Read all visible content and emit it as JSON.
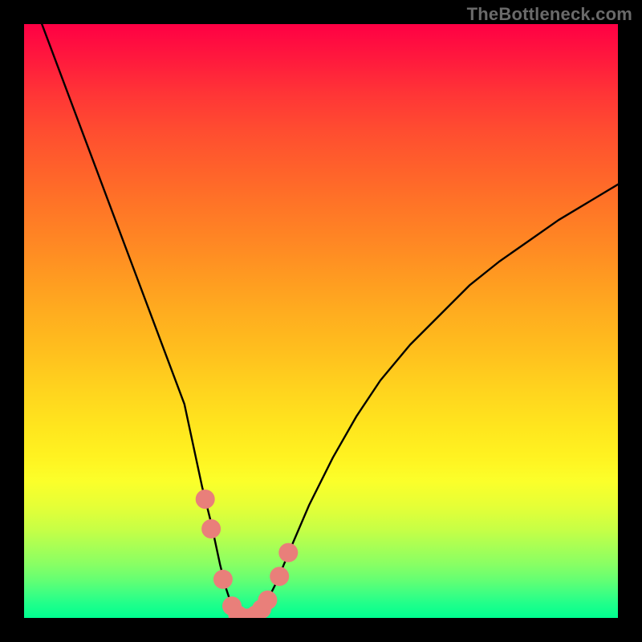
{
  "watermark": {
    "text": "TheBottleneck.com"
  },
  "chart_data": {
    "type": "line",
    "title": "",
    "xlabel": "",
    "ylabel": "",
    "xlim": [
      0,
      100
    ],
    "ylim": [
      0,
      100
    ],
    "grid": false,
    "series": [
      {
        "name": "bottleneck-curve",
        "color": "#000000",
        "x": [
          3,
          6,
          9,
          12,
          15,
          18,
          21,
          24,
          27,
          30,
          31.5,
          33,
          34,
          35,
          36,
          37,
          38,
          39,
          40,
          41,
          42.5,
          45,
          48,
          52,
          56,
          60,
          65,
          70,
          75,
          80,
          85,
          90,
          95,
          100
        ],
        "y": [
          100,
          92,
          84,
          76,
          68,
          60,
          52,
          44,
          36,
          22,
          16,
          9,
          5,
          2,
          0.5,
          0,
          0,
          0.5,
          1.5,
          3,
          6,
          12,
          19,
          27,
          34,
          40,
          46,
          51,
          56,
          60,
          63.5,
          67,
          70,
          73
        ]
      }
    ],
    "markers": [
      {
        "name": "min-region-markers",
        "color": "#e97f7a",
        "points": [
          {
            "x": 30.5,
            "y": 20
          },
          {
            "x": 31.5,
            "y": 15
          },
          {
            "x": 33.5,
            "y": 6.5
          },
          {
            "x": 35,
            "y": 2
          },
          {
            "x": 36,
            "y": 0.5
          },
          {
            "x": 37,
            "y": 0
          },
          {
            "x": 38,
            "y": 0
          },
          {
            "x": 39,
            "y": 0.5
          },
          {
            "x": 40,
            "y": 1.5
          },
          {
            "x": 41,
            "y": 3
          },
          {
            "x": 43,
            "y": 7
          },
          {
            "x": 44.5,
            "y": 11
          }
        ]
      }
    ],
    "gradient_stops": [
      {
        "pct": 0,
        "color": "#ff0044"
      },
      {
        "pct": 50,
        "color": "#ffab1f"
      },
      {
        "pct": 75,
        "color": "#fbff2a"
      },
      {
        "pct": 100,
        "color": "#00ff90"
      }
    ]
  }
}
